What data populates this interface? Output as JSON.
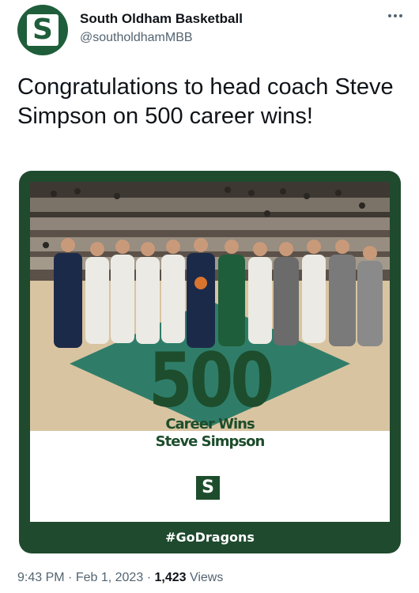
{
  "account": {
    "display_name": "South Oldham Basketball",
    "handle": "@southoldhamMBB",
    "avatar_letter": "S"
  },
  "tweet": {
    "text": "Congratulations to head coach Steve Simpson on 500 career wins!"
  },
  "media": {
    "big_number": "500",
    "caption_line1": "Career Wins",
    "caption_line2": "Steve Simpson",
    "badge_letter": "S",
    "hashtag": "#GoDragons",
    "colors": {
      "brand_green": "#1d4d2c",
      "court_green": "#2f7d69"
    }
  },
  "meta": {
    "time": "9:43 PM",
    "date": "Feb 1, 2023",
    "views_count": "1,423",
    "views_label": "Views",
    "separator": "·"
  },
  "icons": {
    "more": "more-horizontal-icon"
  }
}
